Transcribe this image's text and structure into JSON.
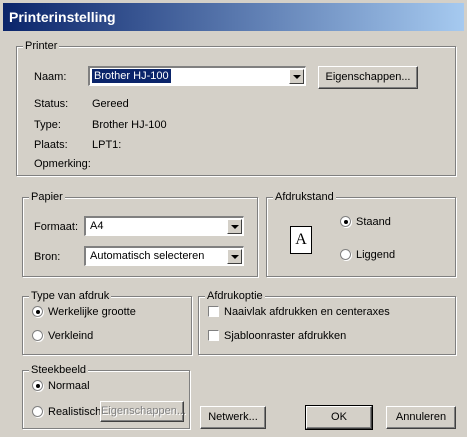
{
  "window": {
    "title": "Printerinstelling"
  },
  "printer": {
    "group_label": "Printer",
    "name_label": "Naam:",
    "name_value": "Brother HJ-100",
    "properties_button": "Eigenschappen...",
    "status_label": "Status:",
    "status_value": "Gereed",
    "type_label": "Type:",
    "type_value": "Brother HJ-100",
    "location_label": "Plaats:",
    "location_value": "LPT1:",
    "comment_label": "Opmerking:"
  },
  "paper": {
    "group_label": "Papier",
    "size_label": "Formaat:",
    "size_value": "A4",
    "source_label": "Bron:",
    "source_value": "Automatisch selecteren"
  },
  "orientation": {
    "group_label": "Afdrukstand",
    "icon_letter": "A",
    "portrait_label": "Staand",
    "landscape_label": "Liggend",
    "selected": "Staand"
  },
  "print_type": {
    "group_label": "Type van afdruk",
    "actual_size_label": "Werkelijke grootte",
    "reduced_label": "Verkleind",
    "selected": "Werkelijke grootte"
  },
  "print_options": {
    "group_label": "Afdrukoptie",
    "center_label": "Naaivlak afdrukken en centeraxes",
    "center_checked": false,
    "grid_label": "Sjabloonraster afdrukken",
    "grid_checked": false
  },
  "stamp_image": {
    "group_label": "Steekbeeld",
    "normal_label": "Normaal",
    "realistic_label": "Realistisch",
    "properties_button": "Eigenschappen...",
    "selected": "Normaal"
  },
  "buttons": {
    "network": "Netwerk...",
    "ok": "OK",
    "cancel": "Annuleren"
  }
}
